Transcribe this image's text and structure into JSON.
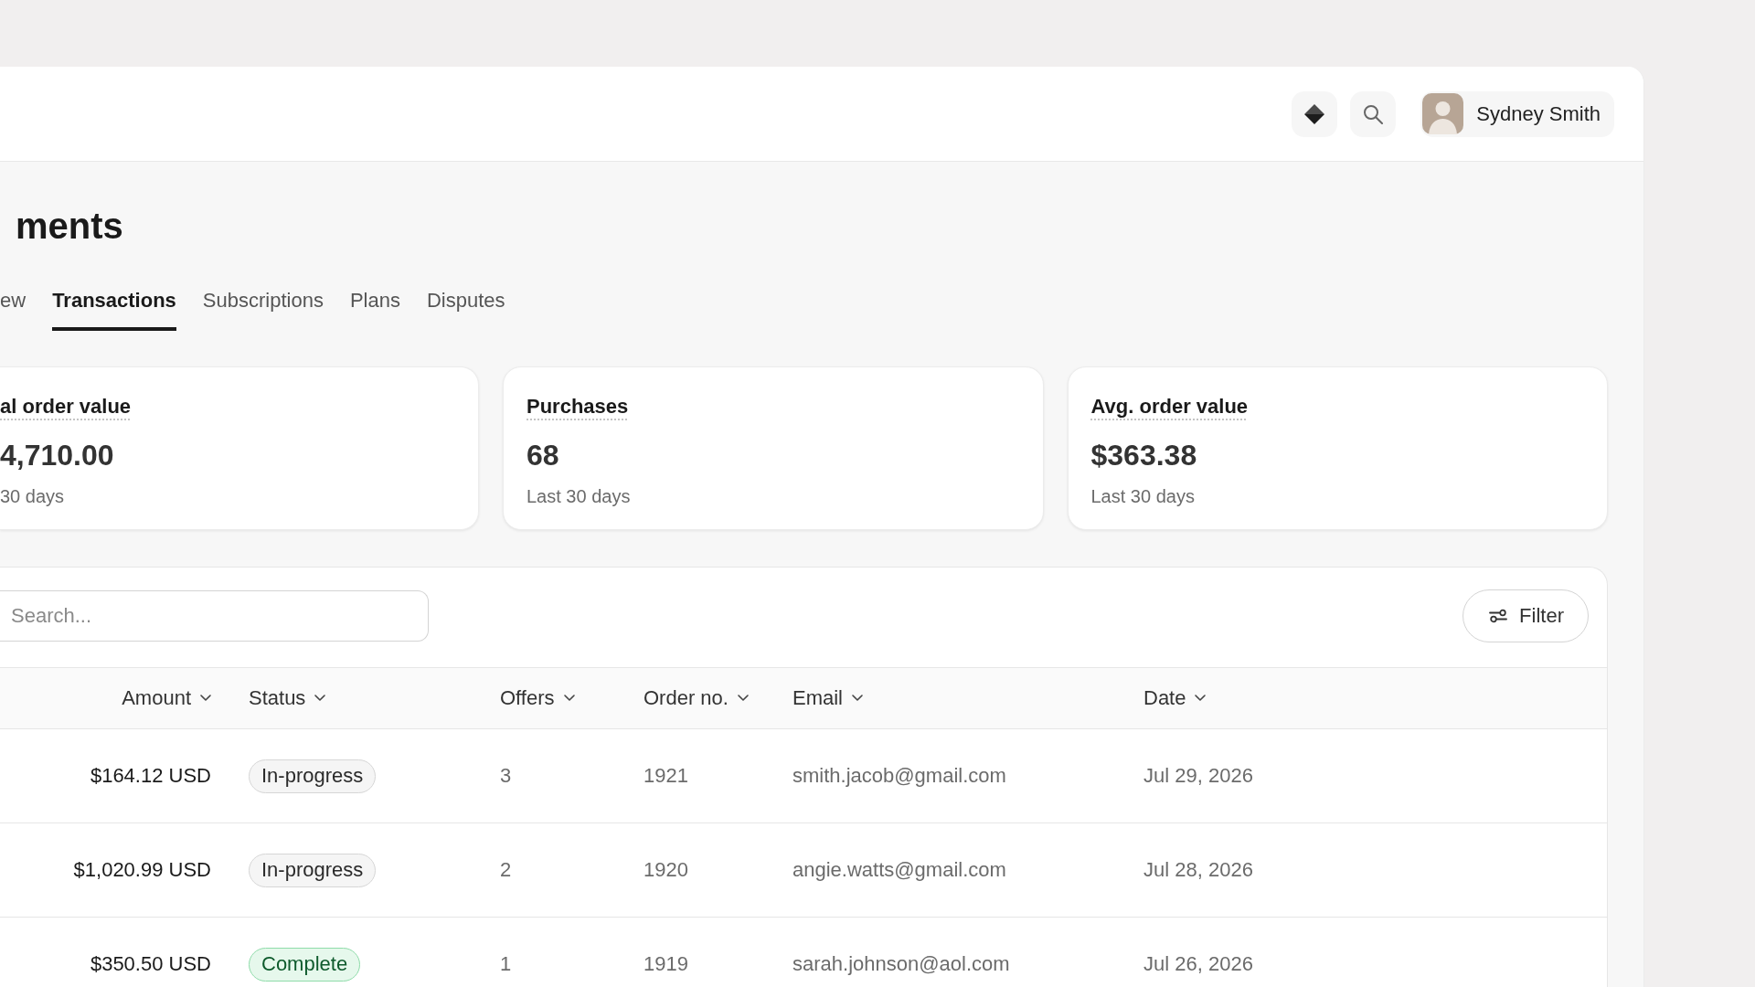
{
  "header": {
    "user": {
      "name": "Sydney Smith"
    }
  },
  "page": {
    "title": "ments"
  },
  "tabs": [
    {
      "label": "ew",
      "selected": false
    },
    {
      "label": "Transactions",
      "selected": true
    },
    {
      "label": "Subscriptions",
      "selected": false
    },
    {
      "label": "Plans",
      "selected": false
    },
    {
      "label": "Disputes",
      "selected": false
    }
  ],
  "stat_cards": [
    {
      "title": "al order value",
      "value": "4,710.00",
      "period": "30 days"
    },
    {
      "title": "Purchases",
      "value": "68",
      "period": "Last 30 days"
    },
    {
      "title": "Avg. order value",
      "value": "$363.38",
      "period": "Last 30 days"
    }
  ],
  "table": {
    "search": {
      "placeholder": "Search..."
    },
    "filter_button": {
      "label": "Filter"
    },
    "columns": [
      "Amount",
      "Status",
      "Offers",
      "Order no.",
      "Email",
      "Date"
    ],
    "rows": [
      {
        "amount": "$164.12 USD",
        "status": {
          "label": "In-progress",
          "kind": "neutral"
        },
        "offers": "3",
        "order_no": "1921",
        "email": "smith.jacob@gmail.com",
        "date": "Jul 29, 2026"
      },
      {
        "amount": "$1,020.99 USD",
        "status": {
          "label": "In-progress",
          "kind": "neutral"
        },
        "offers": "2",
        "order_no": "1920",
        "email": "angie.watts@gmail.com",
        "date": "Jul 28, 2026"
      },
      {
        "amount": "$350.50 USD",
        "status": {
          "label": "Complete",
          "kind": "success"
        },
        "offers": "1",
        "order_no": "1919",
        "email": "sarah.johnson@aol.com",
        "date": "Jul 26, 2026"
      }
    ]
  }
}
